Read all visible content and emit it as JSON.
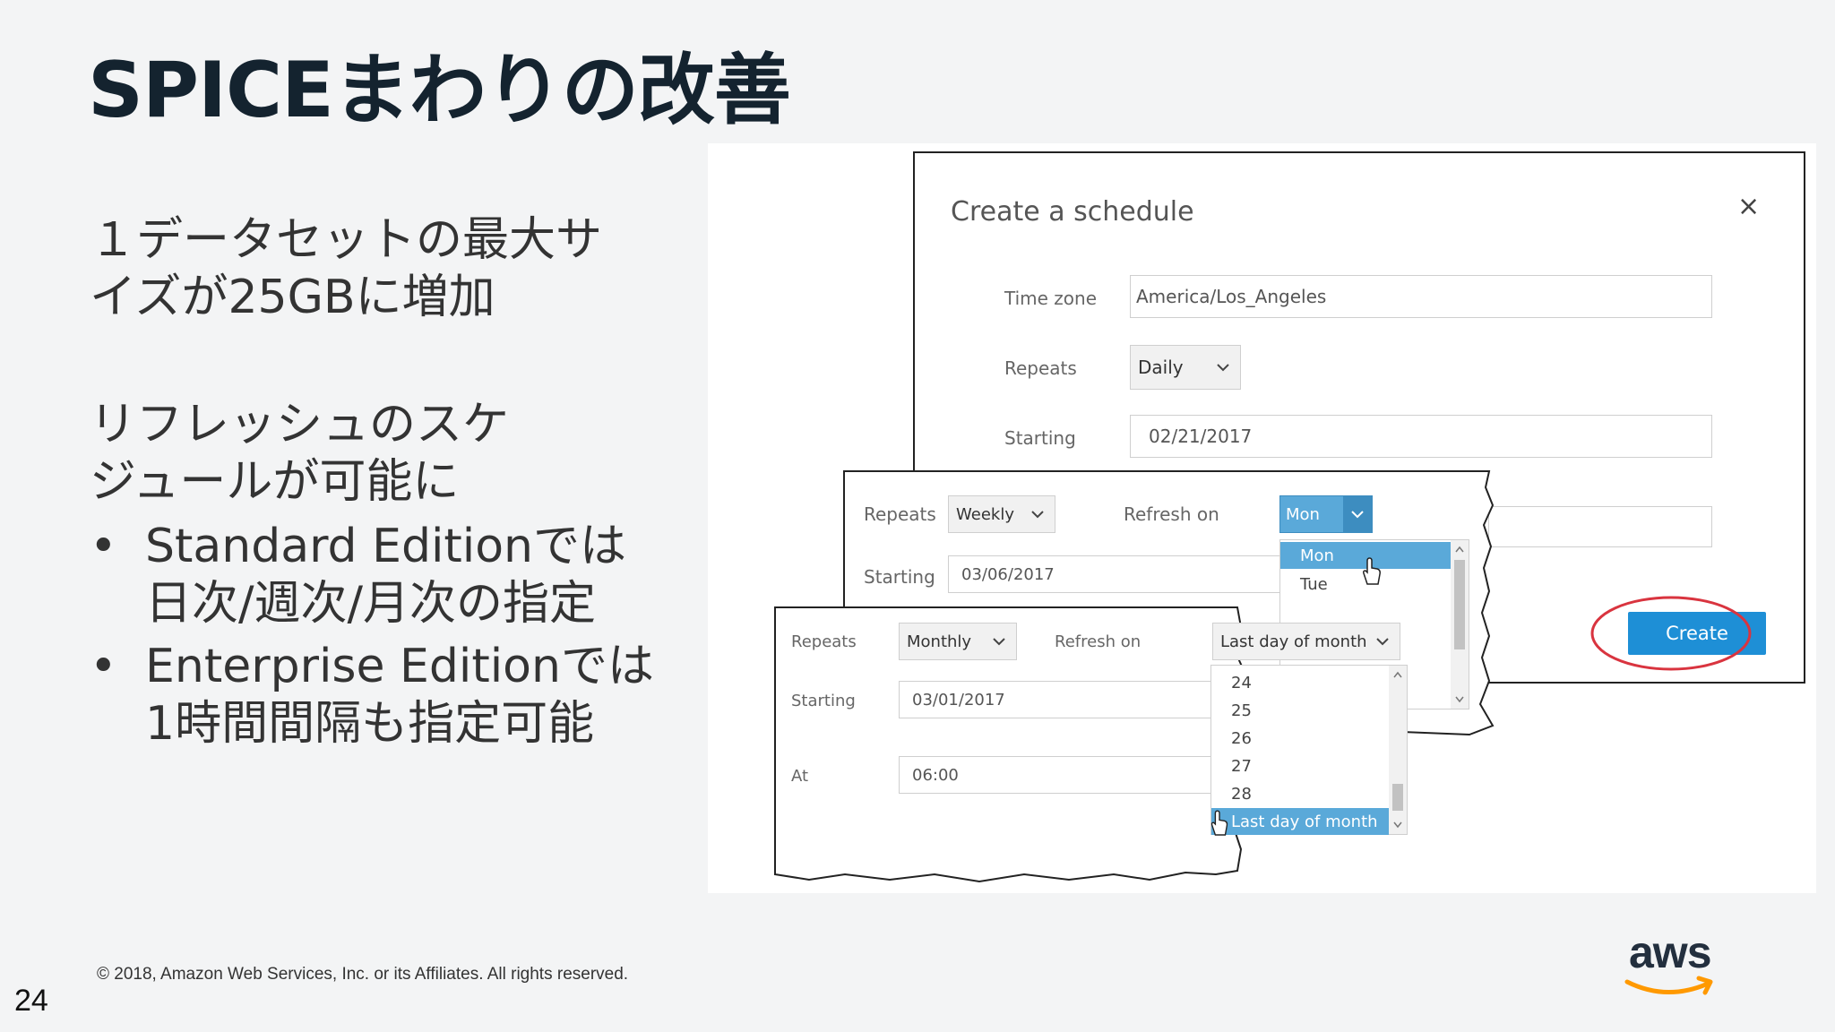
{
  "slide": {
    "title": "SPICEまわりの改善",
    "point1_line1": "１データセットの最大サ",
    "point1_line2": "イズが25GBに増加",
    "point2_line1": "リフレッシュのスケ",
    "point2_line2": "ジュールが可能に",
    "bullet_char": "•",
    "bullet1_line1": "Standard Editionでは",
    "bullet1_line2": "日次/週次/月次の指定",
    "bullet2_line1": "Enterprise Editionでは",
    "bullet2_line2": "1時間間隔も指定可能",
    "footer": "© 2018, Amazon Web Services, Inc. or its Affiliates. All rights reserved.",
    "page_number": "24",
    "logo_text": "aws"
  },
  "schedule_dialog": {
    "title": "Create a schedule",
    "close_glyph": "×",
    "time_zone_label": "Time zone",
    "time_zone_value": "America/Los_Angeles",
    "repeats_label": "Repeats",
    "repeats_value": "Daily",
    "starting_label": "Starting",
    "starting_value": "02/21/2017",
    "create_label": "Create"
  },
  "weekly_panel": {
    "repeats_label": "Repeats",
    "repeats_value": "Weekly",
    "refresh_on_label": "Refresh on",
    "refresh_on_value": "Mon",
    "starting_label": "Starting",
    "starting_value": "03/06/2017",
    "options": [
      "Mon",
      "Tue"
    ]
  },
  "monthly_panel": {
    "repeats_label": "Repeats",
    "repeats_value": "Monthly",
    "refresh_on_label": "Refresh on",
    "refresh_on_value": "Last day of month",
    "starting_label": "Starting",
    "starting_value": "03/01/2017",
    "at_label": "At",
    "at_value": "06:00",
    "options": [
      "24",
      "25",
      "26",
      "27",
      "28",
      "Last day of month"
    ]
  },
  "colors": {
    "title": "#14232f",
    "accent_blue": "#1e8fd6",
    "selected_item": "#5aa9d9",
    "highlight_circle": "#d9343f",
    "aws_orange": "#ff9900"
  }
}
